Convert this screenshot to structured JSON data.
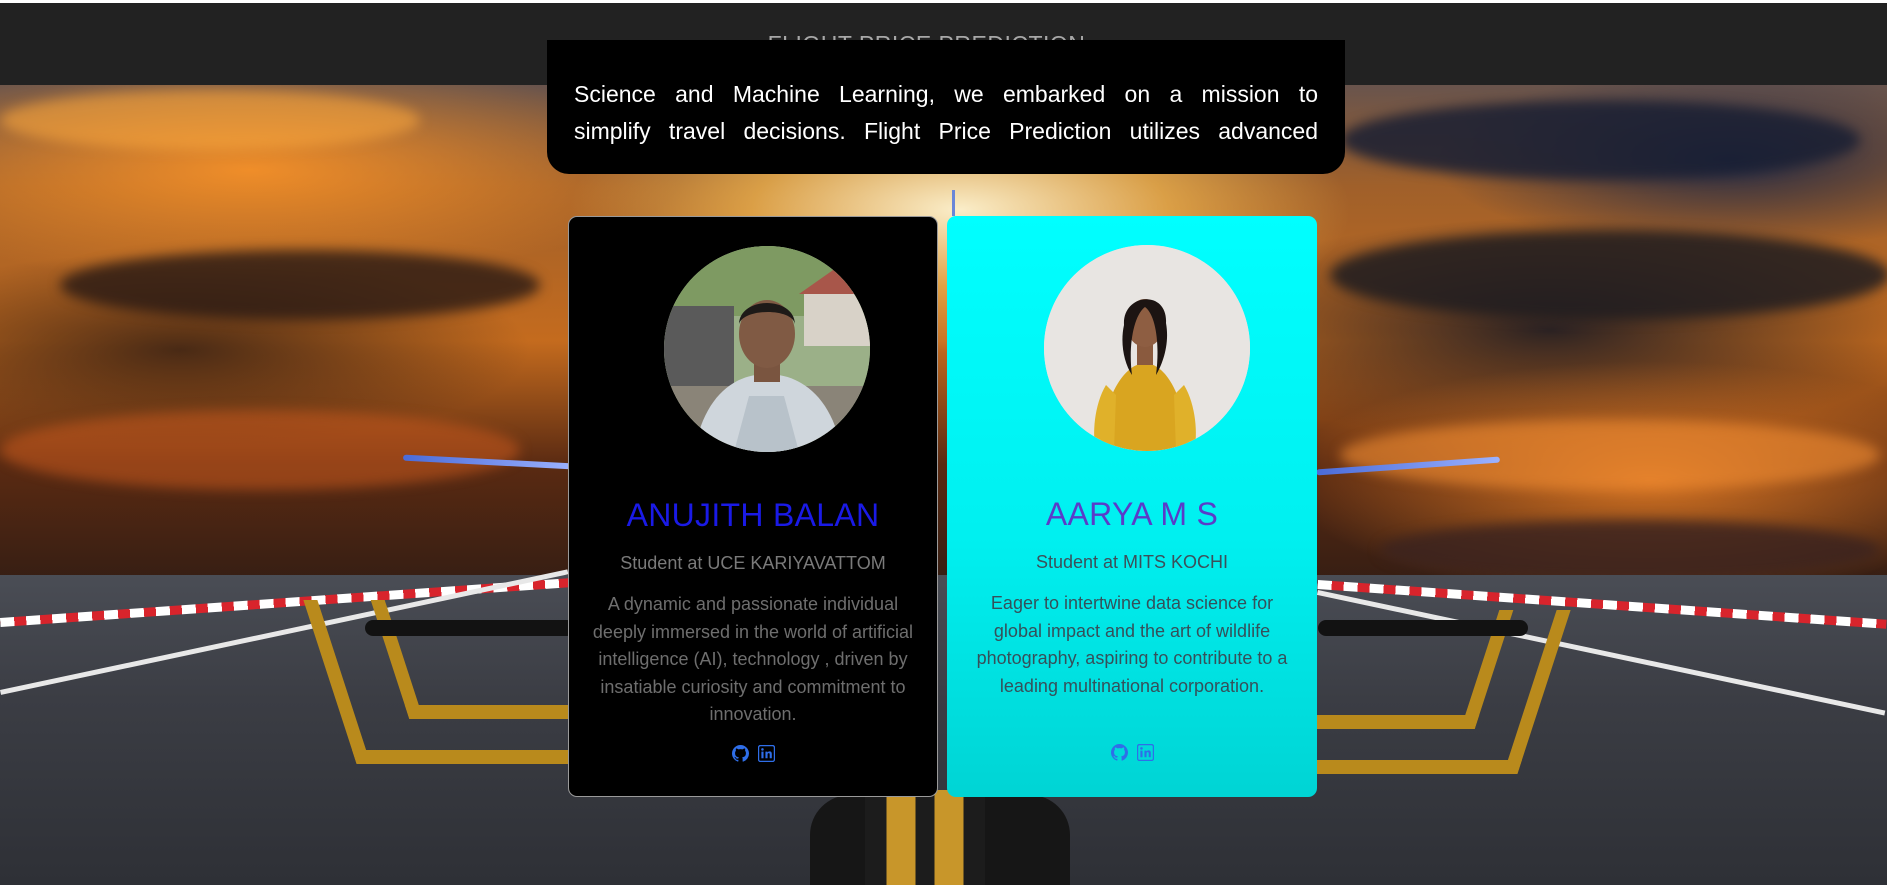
{
  "header": {
    "title": "FLIGHT PRICE PREDICTION"
  },
  "about": {
    "line1": "Science and Machine Learning, we embarked on a mission to",
    "line2": "simplify travel decisions. Flight Price Prediction utilizes advanced"
  },
  "team": [
    {
      "name": "ANUJITH BALAN",
      "role": "Student at UCE KARIYAVATTOM",
      "bio": "A dynamic and passionate individual deeply immersed in the world of artificial intelligence (AI), technology , driven by insatiable curiosity and commitment to innovation.",
      "social": [
        "github-icon",
        "linkedin-icon"
      ]
    },
    {
      "name": "AARYA M S",
      "role": "Student at MITS KOCHI",
      "bio": "Eager to intertwine data science for global impact and the art of wildlife photography, aspiring to contribute to a leading multinational corporation.",
      "social": [
        "github-icon",
        "linkedin-icon"
      ]
    }
  ],
  "colors": {
    "topbar": "#222222",
    "card_dark": "#000000",
    "card_cyan": "#00ffff",
    "name_blue": "#1a1ae6",
    "name_purple": "#5a3cc8",
    "icon_blue": "#2f6ee8"
  }
}
